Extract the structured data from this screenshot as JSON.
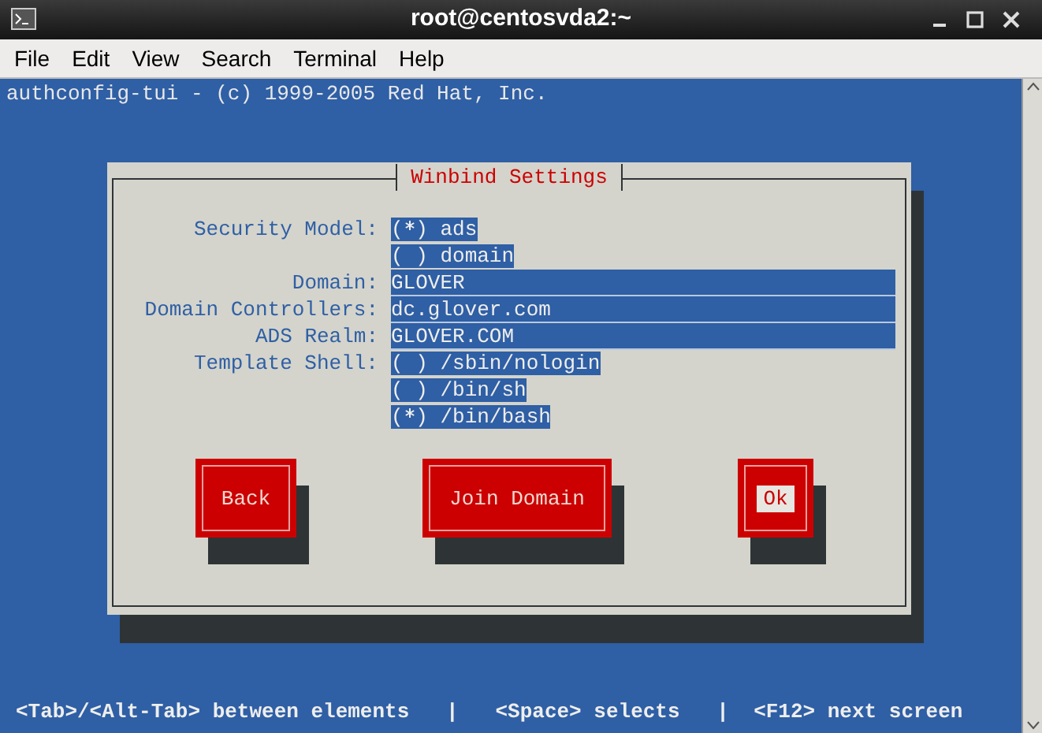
{
  "window": {
    "title": "root@centosvda2:~"
  },
  "menu": [
    "File",
    "Edit",
    "View",
    "Search",
    "Terminal",
    "Help"
  ],
  "terminal": {
    "header": "authconfig-tui - (c) 1999-2005 Red Hat, Inc.",
    "status_line": "<Tab>/<Alt-Tab> between elements   |   <Space> selects   |  <F12> next screen"
  },
  "dialog": {
    "title": "Winbind Settings",
    "radio_brackets": {
      "open": "(",
      "close": ")"
    },
    "rows": [
      {
        "kind": "radio",
        "label": "Security Model:",
        "options": [
          {
            "label": "ads",
            "selected": true
          },
          {
            "label": "domain",
            "selected": false
          }
        ]
      },
      {
        "kind": "field",
        "label": "Domain:",
        "value": "GLOVER"
      },
      {
        "kind": "field",
        "label": "Domain Controllers:",
        "value": "dc.glover.com"
      },
      {
        "kind": "field",
        "label": "ADS Realm:",
        "value": "GLOVER.COM"
      },
      {
        "kind": "radio",
        "label": "Template Shell:",
        "options": [
          {
            "label": "/sbin/nologin",
            "selected": false
          },
          {
            "label": "/bin/sh",
            "selected": false
          },
          {
            "label": "/bin/bash",
            "selected": true
          }
        ]
      }
    ],
    "buttons": [
      {
        "label": "Back",
        "focused": false
      },
      {
        "label": "Join Domain",
        "focused": false
      },
      {
        "label": "Ok",
        "focused": true
      }
    ]
  }
}
